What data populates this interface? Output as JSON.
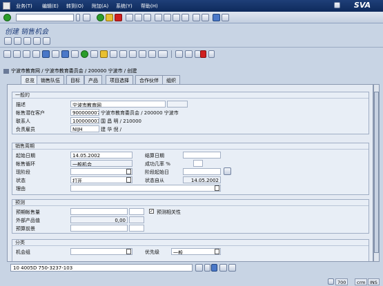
{
  "menu": [
    "业务(T)",
    "编辑(E)",
    "转到(O)",
    "附加(A)",
    "系统(Y)",
    "帮助(H)"
  ],
  "brand": "SVA",
  "command_field": "",
  "title": "创建 销售机会",
  "header_line": "宁波市教育网 / 宁波市教育委员会 / 200000 宁波市 / 创建",
  "tabs": [
    "总览",
    "销售队伍",
    "目标",
    "产品",
    "项目选择",
    "合作伙伴",
    "组织"
  ],
  "active_tab": "总览",
  "general": {
    "title": "一般的",
    "desc_label": "描述",
    "desc_value": "宁波市教育网",
    "prospect_label": "帐售潜在客户",
    "prospect_id": "9000000070",
    "prospect_text": "宁波市教育委员会 / 200000 宁波市",
    "contact_label": "联系人",
    "contact_id": "1000000036",
    "contact_text": "国 昌 明 / 210000",
    "resp_label": "负责雇员",
    "resp_id": "NIJH",
    "resp_text": "建 华 倪 /"
  },
  "period": {
    "title": "销售周期",
    "start_label": "起始日期",
    "start_value": "14.05.2002",
    "end_label": "结算日期",
    "end_value": "",
    "cycle_label": "帐售循环",
    "cycle_value": "一般机会",
    "chance_label": "成功几率 %",
    "chance_value": "",
    "phase_label": "现阶段",
    "phase_value": "",
    "phase_start_label": "阶段起始日",
    "phase_start_value": "",
    "status_label": "状态",
    "status_value": "打开",
    "status_since_label": "状态自从",
    "status_since_value": "14.05.2002",
    "reason_label": "理由",
    "reason_value": ""
  },
  "forecast": {
    "title": "预测",
    "expected_label": "预期帐售量",
    "expected_value": "",
    "weighted_label": "外部产品值",
    "weighted_value": "0,00",
    "budget_label": "预算前景",
    "budget_value": "",
    "relevant_label": "预测相关性",
    "relevant_checked": true
  },
  "classification": {
    "title": "分类",
    "group_label": "机会组",
    "group_value": "",
    "priority_label": "优先级",
    "priority_value": "一般"
  },
  "status_field": "10 4005D 750-3237-103",
  "sysinfo": {
    "code": "700",
    "server": "crm",
    "mode": "INS"
  }
}
